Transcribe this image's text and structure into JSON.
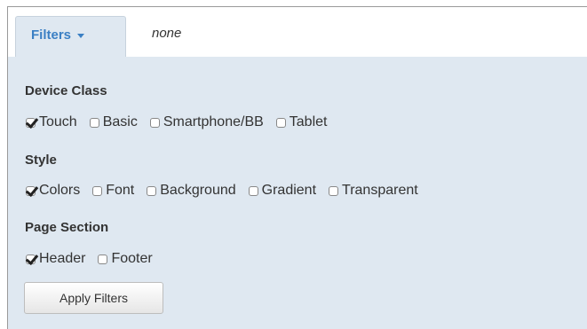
{
  "filters_tab": {
    "label": "Filters",
    "current_value": "none"
  },
  "sections": [
    {
      "title": "Device Class",
      "options": [
        {
          "label": "Touch",
          "checked": true
        },
        {
          "label": "Basic",
          "checked": false
        },
        {
          "label": "Smartphone/BB",
          "checked": false
        },
        {
          "label": "Tablet",
          "checked": false
        }
      ]
    },
    {
      "title": "Style",
      "options": [
        {
          "label": "Colors",
          "checked": true
        },
        {
          "label": "Font",
          "checked": false
        },
        {
          "label": "Background",
          "checked": false
        },
        {
          "label": "Gradient",
          "checked": false
        },
        {
          "label": "Transparent",
          "checked": false
        }
      ]
    },
    {
      "title": "Page Section",
      "options": [
        {
          "label": "Header",
          "checked": true
        },
        {
          "label": "Footer",
          "checked": false
        }
      ]
    }
  ],
  "apply_button": {
    "label": "Apply Filters"
  },
  "colors": {
    "accent": "#3a7fc4",
    "panel": "#dfe8f1"
  }
}
